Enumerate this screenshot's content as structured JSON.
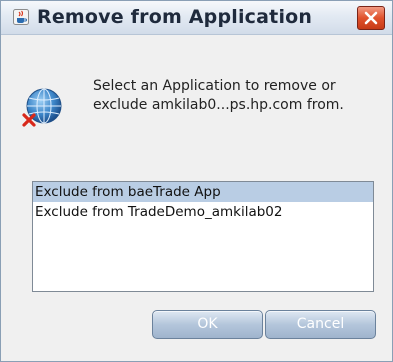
{
  "window": {
    "title": "Remove from Application",
    "icons": {
      "app": "java-cup-icon",
      "close": "close-icon",
      "message": "network-globe-remove-icon"
    },
    "colors": {
      "close_button": "#e0522d",
      "selected_row": "#b9cde4",
      "button_face": "#b4c6db"
    }
  },
  "message": {
    "text": "Select an Application to remove or exclude amkilab0...ps.hp.com from."
  },
  "list": {
    "items": [
      {
        "label": "Exclude from baeTrade App",
        "selected": true
      },
      {
        "label": "Exclude from TradeDemo_amkilab02",
        "selected": false
      }
    ]
  },
  "buttons": {
    "ok_label": "OK",
    "cancel_label": "Cancel"
  }
}
